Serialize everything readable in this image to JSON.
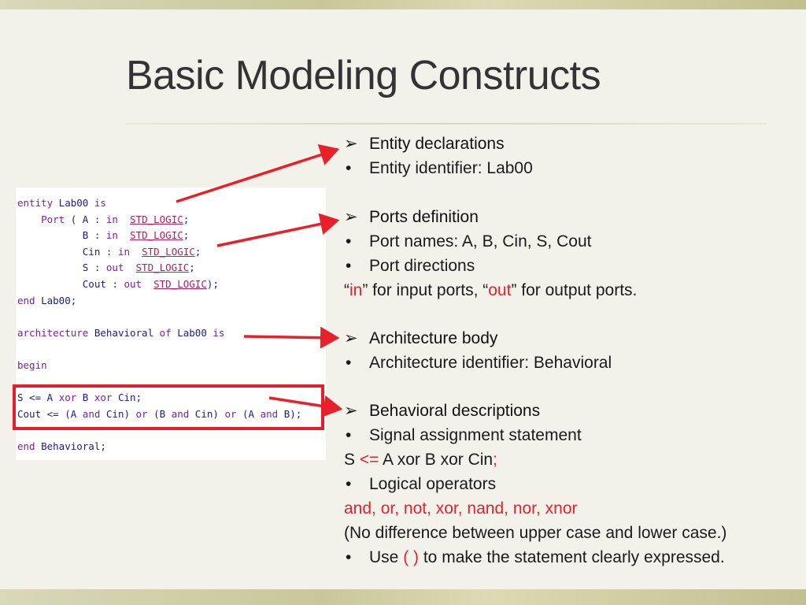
{
  "slide": {
    "title": "Basic Modeling Constructs"
  },
  "code": {
    "lines": [
      {
        "parts": [
          [
            "k",
            "entity"
          ],
          [
            "n",
            " Lab00 "
          ],
          [
            "k",
            "is"
          ]
        ]
      },
      {
        "parts": [
          [
            "n",
            "    "
          ],
          [
            "k",
            "Port"
          ],
          [
            "n",
            " ( A : "
          ],
          [
            "k",
            "in"
          ],
          [
            "n",
            "  "
          ],
          [
            "t",
            "STD_LOGIC"
          ],
          [
            "n",
            ";"
          ]
        ]
      },
      {
        "parts": [
          [
            "n",
            "           B : "
          ],
          [
            "k",
            "in"
          ],
          [
            "n",
            "  "
          ],
          [
            "t",
            "STD_LOGIC"
          ],
          [
            "n",
            ";"
          ]
        ]
      },
      {
        "parts": [
          [
            "n",
            "           Cin : "
          ],
          [
            "k",
            "in"
          ],
          [
            "n",
            "  "
          ],
          [
            "t",
            "STD_LOGIC"
          ],
          [
            "n",
            ";"
          ]
        ]
      },
      {
        "parts": [
          [
            "n",
            "           S : "
          ],
          [
            "k",
            "out"
          ],
          [
            "n",
            "  "
          ],
          [
            "t",
            "STD_LOGIC"
          ],
          [
            "n",
            ";"
          ]
        ]
      },
      {
        "parts": [
          [
            "n",
            "           Cout : "
          ],
          [
            "k",
            "out"
          ],
          [
            "n",
            "  "
          ],
          [
            "t",
            "STD_LOGIC"
          ],
          [
            "n",
            ");"
          ]
        ]
      },
      {
        "parts": [
          [
            "k",
            "end"
          ],
          [
            "n",
            " Lab00;"
          ]
        ]
      },
      {
        "parts": []
      },
      {
        "parts": [
          [
            "k",
            "architecture"
          ],
          [
            "n",
            " Behavioral "
          ],
          [
            "k",
            "of"
          ],
          [
            "n",
            " Lab00 "
          ],
          [
            "k",
            "is"
          ]
        ]
      },
      {
        "parts": []
      },
      {
        "parts": [
          [
            "k",
            "begin"
          ]
        ]
      },
      {
        "parts": []
      },
      {
        "parts": [
          [
            "n",
            "S <= A "
          ],
          [
            "k",
            "xor"
          ],
          [
            "n",
            " B "
          ],
          [
            "k",
            "xor"
          ],
          [
            "n",
            " Cin;"
          ]
        ]
      },
      {
        "parts": [
          [
            "n",
            "Cout <= (A "
          ],
          [
            "k",
            "and"
          ],
          [
            "n",
            " Cin) "
          ],
          [
            "k",
            "or"
          ],
          [
            "n",
            " (B "
          ],
          [
            "k",
            "and"
          ],
          [
            "n",
            " Cin) "
          ],
          [
            "k",
            "or"
          ],
          [
            "n",
            " (A "
          ],
          [
            "k",
            "and"
          ],
          [
            "n",
            " B);"
          ]
        ]
      },
      {
        "parts": []
      },
      {
        "parts": [
          [
            "k",
            "end"
          ],
          [
            "n",
            " Behavioral;"
          ]
        ]
      }
    ]
  },
  "content": {
    "entity_head": "Entity declarations",
    "entity_id": "Entity identifier: Lab00",
    "ports_head": "Ports definition",
    "port_names": "Port names: A, B, Cin, S, Cout",
    "port_dirs": "Port directions",
    "dir_q1": "“",
    "dir_in": "in",
    "dir_mid": "” for input ports, “",
    "dir_out": "out",
    "dir_end": "” for output ports.",
    "arch_head": "Architecture body",
    "arch_id": "Architecture identifier: Behavioral",
    "behav_head": "Behavioral descriptions",
    "signal_stmt": "Signal assignment statement",
    "s_pre": "S ",
    "s_op": "<=",
    "s_mid": " A xor B xor Cin",
    "s_semi": ";",
    "logical_ops": "Logical operators",
    "ops_list": "and, or, not, xor, nand, nor, xnor",
    "no_diff": "(No difference between upper case and lower case.)",
    "use_pre": "Use ",
    "use_paren": "( )",
    "use_post": " to make the statement clearly expressed."
  },
  "icons": {
    "arrow_bullet": "right-arrowhead-icon",
    "dot_bullet": "bullet-dot-icon",
    "pointer": "red-arrow-icon"
  },
  "colors": {
    "accent_red": "#e8202a",
    "keyword": "#7a1fa2",
    "type": "#c2185b",
    "code_text": "#1a1a8c"
  }
}
